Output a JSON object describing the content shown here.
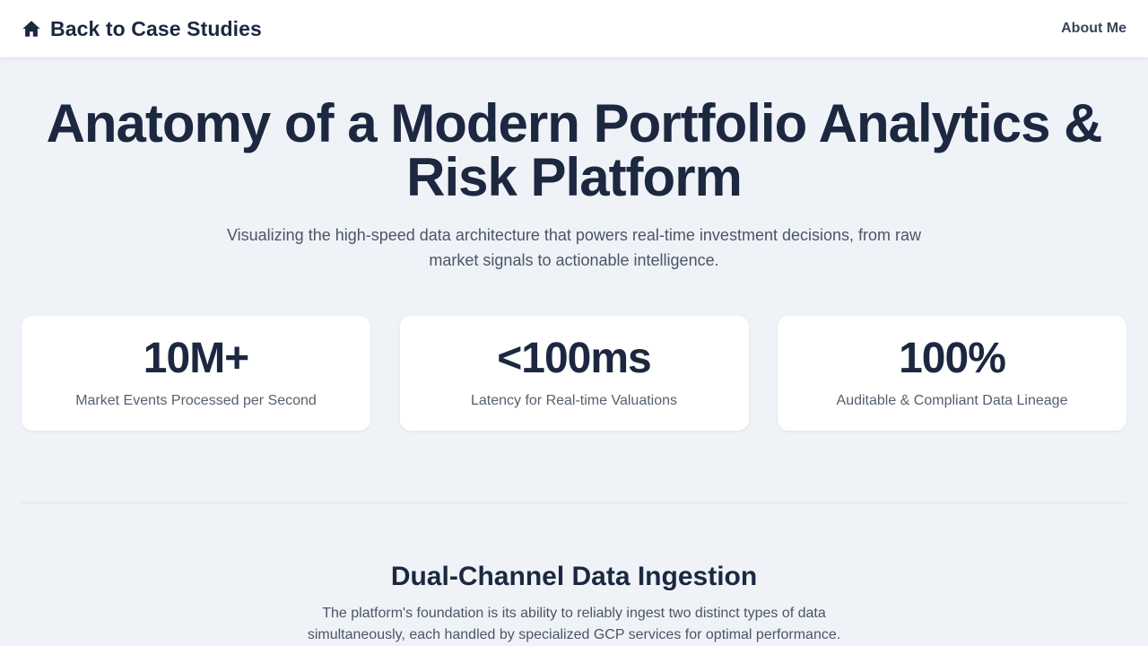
{
  "header": {
    "back_label": "Back to Case Studies",
    "about_label": "About Me",
    "back_icon": "home-icon"
  },
  "hero": {
    "title": "Anatomy of a Modern Portfolio Analytics & Risk Platform",
    "subtitle": "Visualizing the high-speed data architecture that powers real-time investment decisions, from raw market signals to actionable intelligence."
  },
  "stats": [
    {
      "value": "10M+",
      "label": "Market Events Processed per Second"
    },
    {
      "value": "<100ms",
      "label": "Latency for Real-time Valuations"
    },
    {
      "value": "100%",
      "label": "Auditable & Compliant Data Lineage"
    }
  ],
  "section": {
    "title": "Dual-Channel Data Ingestion",
    "description": "The platform's foundation is its ability to reliably ingest two distinct types of data simultaneously, each handled by specialized GCP services for optimal performance."
  },
  "colors": {
    "background": "#eff3f8",
    "text_primary": "#1c2840",
    "text_secondary": "#4a5568",
    "card": "#ffffff"
  }
}
